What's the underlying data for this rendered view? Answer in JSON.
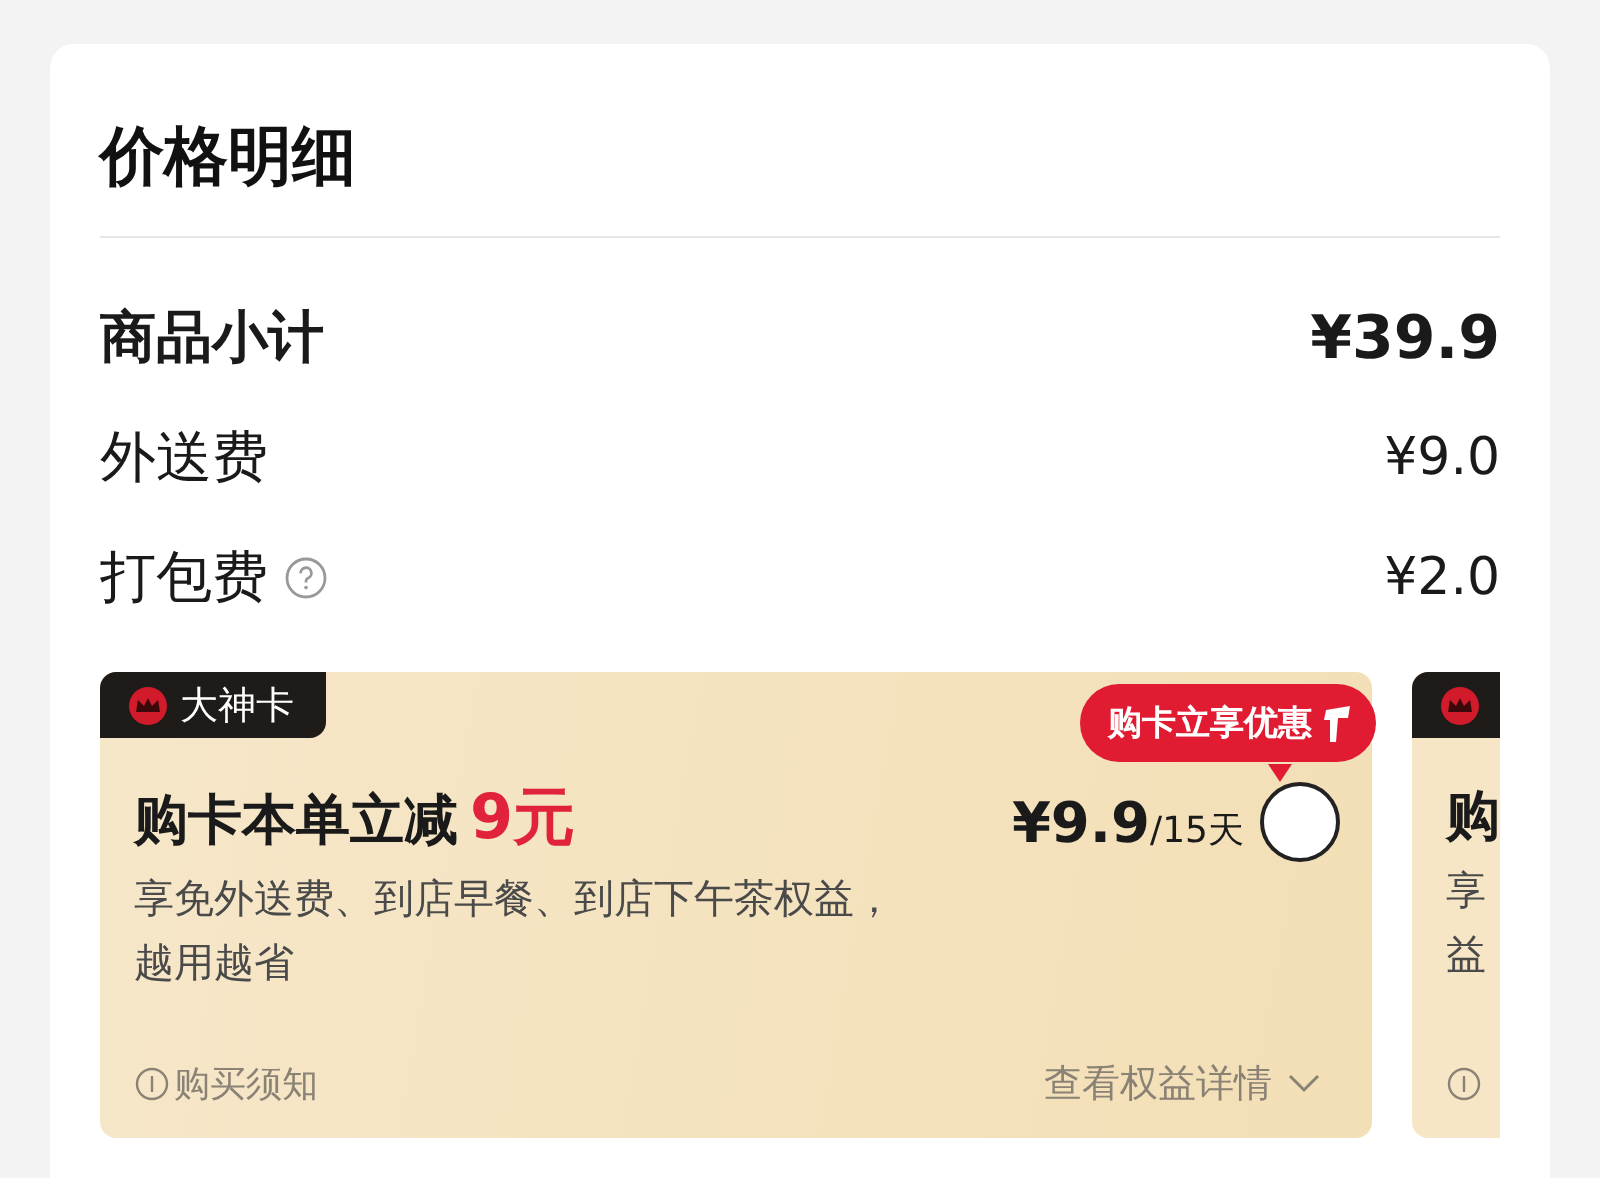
{
  "title": "价格明细",
  "fees": [
    {
      "label": "商品小计",
      "amount": "¥39.9",
      "kind": "subtotal",
      "help": false
    },
    {
      "label": "外送费",
      "amount": "¥9.0",
      "kind": "fee",
      "help": false
    },
    {
      "label": "打包费",
      "amount": "¥2.0",
      "kind": "fee",
      "help": true
    }
  ],
  "card": {
    "badge": "大神卡",
    "title": "购卡本单立减",
    "highlight": "9元",
    "description": "享免外送费、到店早餐、到店下午茶权益，越用越省",
    "notice": "购买须知",
    "promo": "购卡立享优惠",
    "price": "¥9.9",
    "period": "/15天",
    "selected": false,
    "details": "查看权益详情"
  },
  "next_card": {
    "title": "购",
    "description_lines": [
      "享",
      "益"
    ]
  }
}
